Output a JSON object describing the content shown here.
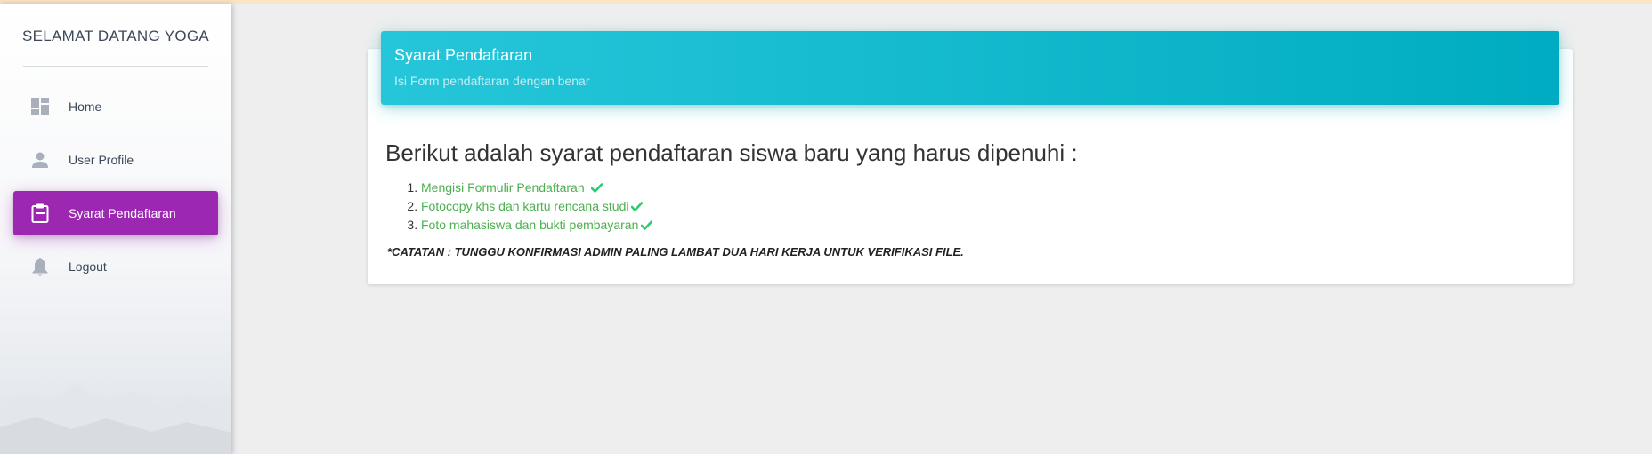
{
  "sidebar": {
    "brand": "SELAMAT DATANG YOGA",
    "items": [
      {
        "label": "Home",
        "icon": "dashboard-icon",
        "active": false
      },
      {
        "label": "User Profile",
        "icon": "person-icon",
        "active": false
      },
      {
        "label": "Syarat Pendaftaran",
        "icon": "clipboard-icon",
        "active": true
      },
      {
        "label": "Logout",
        "icon": "bell-icon",
        "active": false
      }
    ]
  },
  "card": {
    "title": "Syarat Pendaftaran",
    "subtitle": "Isi Form pendaftaran dengan benar",
    "heading": "Berikut adalah syarat pendaftaran siswa baru yang harus dipenuhi :",
    "requirements": [
      "Mengisi Formulir Pendaftaran ",
      "Fotocopy khs dan kartu rencana studi",
      "Foto mahasiswa dan bukti pembayaran"
    ],
    "note": "*CATATAN : TUNGGU KONFIRMASI ADMIN PALING LAMBAT DUA HARI KERJA UNTUK VERIFIKASI FILE."
  },
  "colors": {
    "active_nav": "#9c27b0",
    "header_start": "#26c6da",
    "header_end": "#00acc1",
    "list_text": "#4caf50",
    "check": "#2ecc71"
  }
}
